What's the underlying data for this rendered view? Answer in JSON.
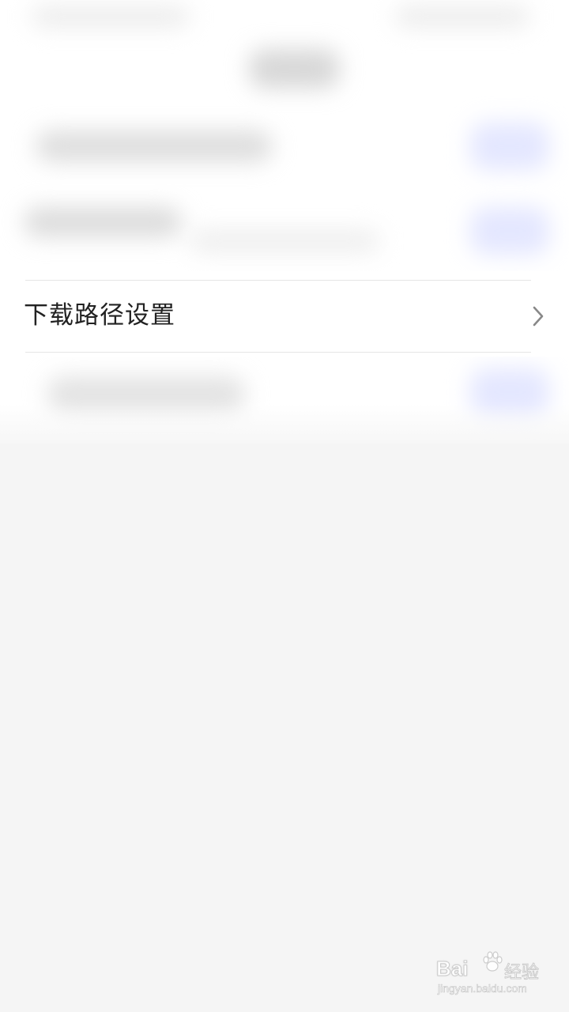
{
  "settings_row": {
    "label": "下载路径设置",
    "icon": "chevron-right-icon"
  },
  "watermark": {
    "brand": "Bai",
    "brand_icon": "paw-icon",
    "suffix": "经验",
    "url": "jingyan.baidu.com"
  },
  "colors": {
    "background": "#f5f5f5",
    "row_background": "#ffffff",
    "text": "#222222",
    "chevron": "#888888",
    "divider": "#e6e6e6"
  }
}
